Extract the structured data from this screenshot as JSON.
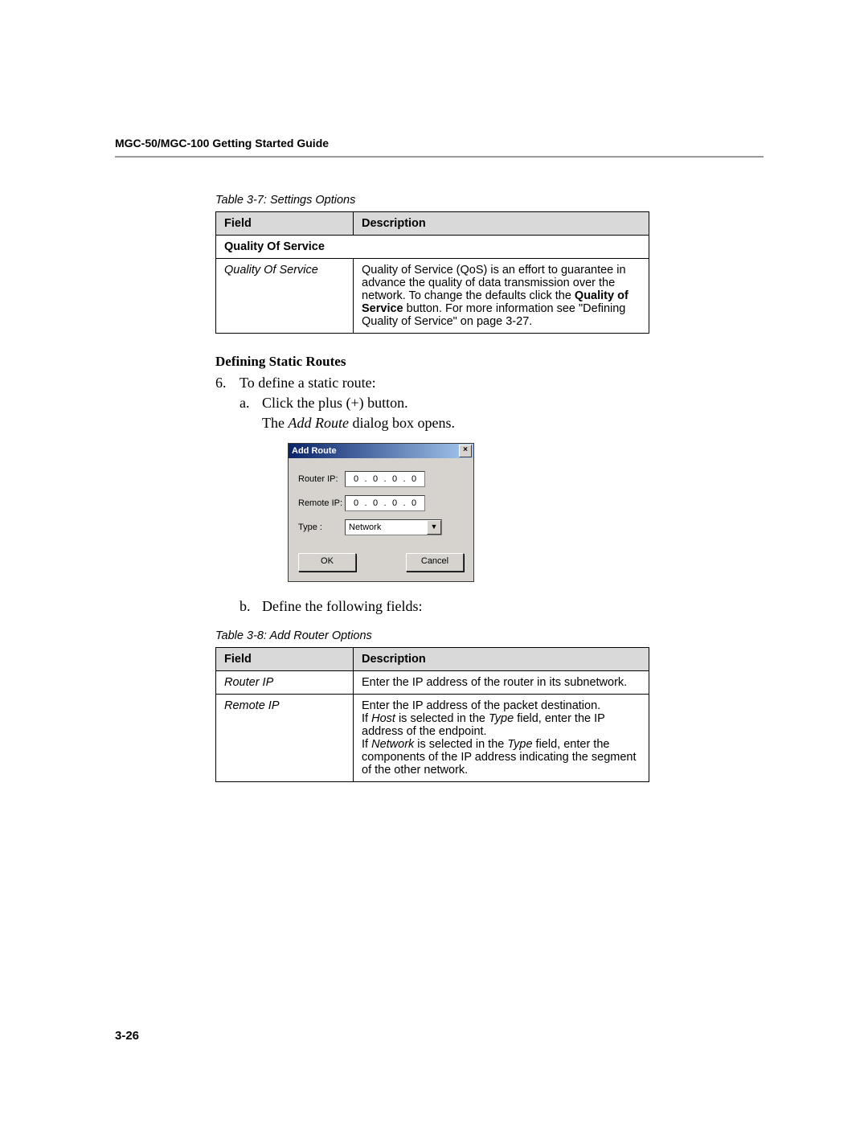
{
  "header": {
    "title": "MGC-50/MGC-100 Getting Started Guide"
  },
  "table1": {
    "caption": "Table 3-7: Settings Options",
    "columns": {
      "field": "Field",
      "description": "Description"
    },
    "subheader": "Quality Of Service",
    "row": {
      "field": "Quality Of Service",
      "desc_pre": "Quality of Service (QoS) is an effort to guarantee in advance the quality of data transmission over the network. To change the defaults click the ",
      "desc_bold": "Quality of Service",
      "desc_post": " button. For more information see \"Defining Quality of Service\" on page 3-27."
    }
  },
  "section": {
    "heading": "Defining Static Routes",
    "step6": {
      "num": "6.",
      "text": "To define a static route:",
      "a": {
        "letter": "a.",
        "text": "Click the plus (+) button."
      },
      "followup_pre": "The ",
      "followup_italic": "Add Route",
      "followup_post": " dialog box opens.",
      "b": {
        "letter": "b.",
        "text": "Define the following fields:"
      }
    }
  },
  "dialog": {
    "title": "Add Route",
    "close": "×",
    "router_label": "Router IP:",
    "remote_label": "Remote IP:",
    "type_label": "Type :",
    "type_value": "Network",
    "ip_octet": "0",
    "ip_dot": ".",
    "ok": "OK",
    "cancel": "Cancel",
    "arrow": "▼"
  },
  "table2": {
    "caption": "Table 3-8: Add Router Options",
    "columns": {
      "field": "Field",
      "description": "Description"
    },
    "row1": {
      "field": "Router IP",
      "desc": "Enter the IP address of the router in its subnetwork."
    },
    "row2": {
      "field": "Remote IP",
      "l1": "Enter the IP address of the packet destination.",
      "l2_pre": "If ",
      "l2_i1": "Host",
      "l2_mid": " is selected in the ",
      "l2_i2": "Type",
      "l2_post": " field, enter the IP address of the endpoint.",
      "l3_pre": "If ",
      "l3_i1": "Network",
      "l3_mid": " is selected in the ",
      "l3_i2": "Type",
      "l3_post": " field, enter the components of the IP address indicating the segment of the other network."
    }
  },
  "page_number": "3-26"
}
